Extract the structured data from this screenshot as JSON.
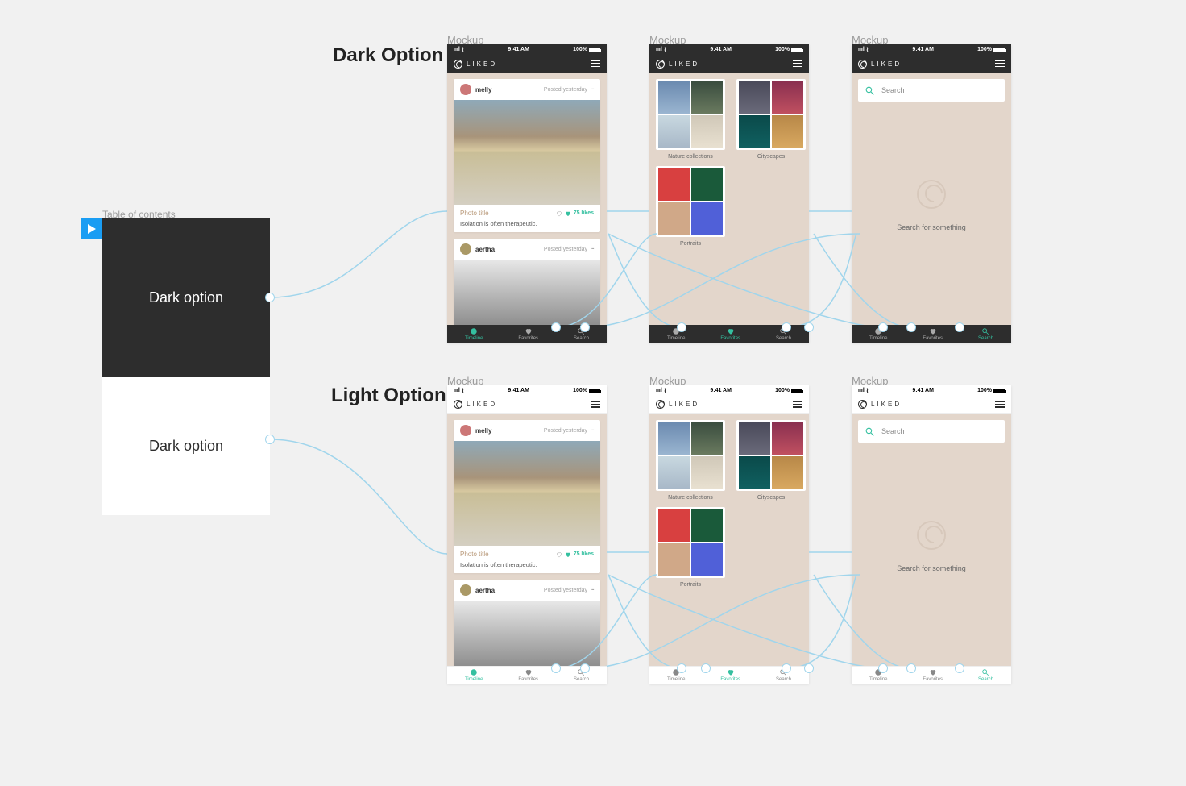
{
  "toc": {
    "label": "Table of contents",
    "dark": "Dark option",
    "light": "Dark option"
  },
  "row_titles": {
    "dark": "Dark Option",
    "light": "Light Option"
  },
  "mockup_label": "Mockup",
  "status": {
    "time": "9:41 AM",
    "signal": "ıııl",
    "wifi": "⌇",
    "battery": "100%"
  },
  "brand": "LIKED",
  "feed": {
    "post1": {
      "user": "melly",
      "meta": "Posted yesterday",
      "title": "Photo title",
      "desc": "Isolation is often therapeutic.",
      "likes": "75 likes"
    },
    "post2": {
      "user": "aertha",
      "meta": "Posted yesterday"
    }
  },
  "collections": {
    "c1": "Nature collections",
    "c2": "Cityscapes",
    "c3": "Portraits"
  },
  "search": {
    "placeholder": "Search",
    "empty": "Search for something"
  },
  "tabs": {
    "timeline": "Timeline",
    "favorites": "Favorites",
    "search": "Search"
  }
}
